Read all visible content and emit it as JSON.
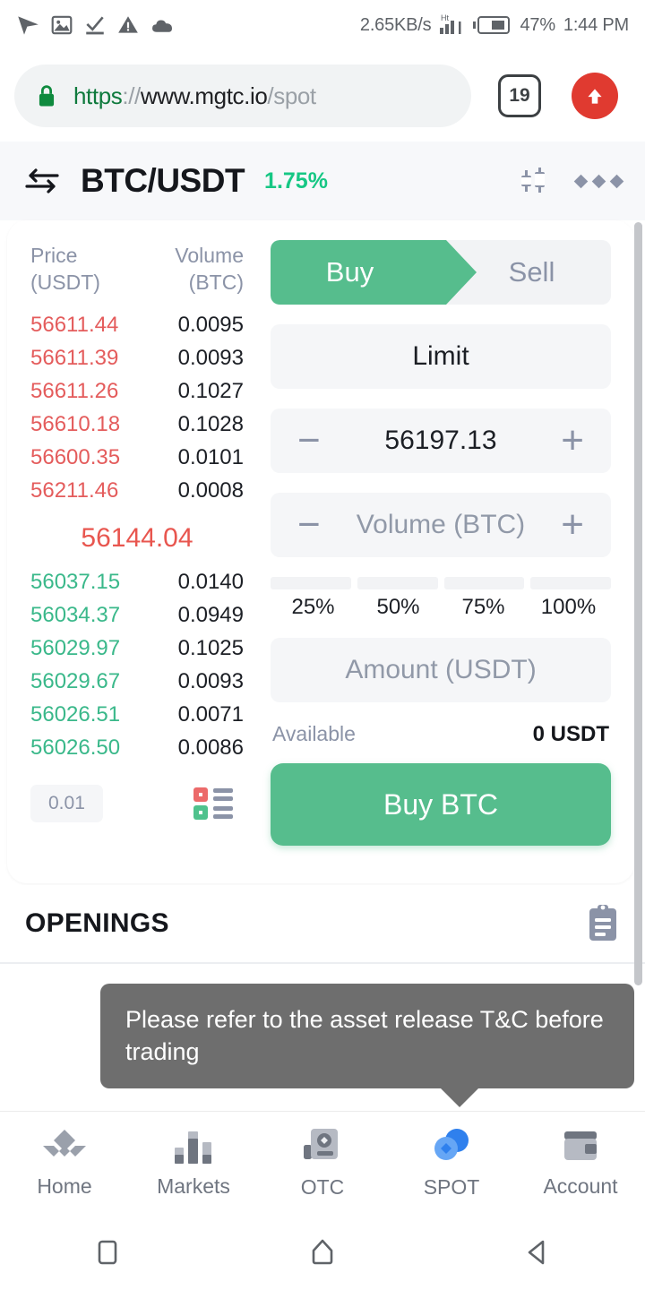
{
  "statusbar": {
    "icons": [
      "send-icon",
      "image-icon",
      "check-download-icon",
      "warning-icon",
      "cloud-icon"
    ],
    "network_speed": "2.65KB/s",
    "battery_percent": "47%",
    "time": "1:44 PM"
  },
  "browser": {
    "url_scheme": "https",
    "url_sep": "://",
    "url_host": "www.mgtc.io",
    "url_path": "/spot",
    "tab_count": "19",
    "lock_icon": "lock-icon",
    "upload_icon": "upload-arrow-icon"
  },
  "app_header": {
    "swap_icon": "swap-arrows-icon",
    "pair": "BTC/USDT",
    "change_percent": "1.75%",
    "change_color": "#16c784",
    "chart_icon": "candlestick-icon",
    "menu_icon": "more-options-icon"
  },
  "orderbook": {
    "header_price_line1": "Price",
    "header_price_line2": "(USDT)",
    "header_volume_line1": "Volume",
    "header_volume_line2": "(BTC)",
    "ask_color": "#e45c5c",
    "bid_color": "#3ab88a",
    "asks": [
      {
        "price": "56611.44",
        "volume": "0.0095"
      },
      {
        "price": "56611.39",
        "volume": "0.0093"
      },
      {
        "price": "56611.26",
        "volume": "0.1027"
      },
      {
        "price": "56610.18",
        "volume": "0.1028"
      },
      {
        "price": "56600.35",
        "volume": "0.0101"
      },
      {
        "price": "56211.46",
        "volume": "0.0008"
      }
    ],
    "last_price": "56144.04",
    "bids": [
      {
        "price": "56037.15",
        "volume": "0.0140"
      },
      {
        "price": "56034.37",
        "volume": "0.0949"
      },
      {
        "price": "56029.97",
        "volume": "0.1025"
      },
      {
        "price": "56029.67",
        "volume": "0.0093"
      },
      {
        "price": "56026.51",
        "volume": "0.0071"
      },
      {
        "price": "56026.50",
        "volume": "0.0086"
      }
    ],
    "tick_size": "0.01",
    "depth_toggle_icon": "orderbook-display-icon"
  },
  "order_form": {
    "buy_label": "Buy",
    "sell_label": "Sell",
    "active_side": "Buy",
    "buy_color": "#56bd8d",
    "order_type": "Limit",
    "price_value": "56197.13",
    "volume_placeholder": "Volume (BTC)",
    "minus_icon": "minus-icon",
    "plus_icon": "plus-icon",
    "percentages": [
      "25%",
      "50%",
      "75%",
      "100%"
    ],
    "amount_placeholder": "Amount (USDT)",
    "available_label": "Available",
    "available_value": "0 USDT",
    "submit_label": "Buy BTC"
  },
  "openings": {
    "title": "OPENINGS",
    "icon": "clipboard-orders-icon"
  },
  "toast": {
    "message": "Please refer to the asset release T&C before trading",
    "background": "#6e6e6e"
  },
  "bottom_nav": {
    "items": [
      {
        "label": "Home",
        "icon": "home-diamond-icon",
        "active": false
      },
      {
        "label": "Markets",
        "icon": "bar-chart-icon",
        "active": false
      },
      {
        "label": "OTC",
        "icon": "otc-document-icon",
        "active": false
      },
      {
        "label": "SPOT",
        "icon": "spot-circles-icon",
        "active": true
      },
      {
        "label": "Account",
        "icon": "wallet-icon",
        "active": false
      }
    ],
    "active_color": "#2f80ed"
  },
  "android_nav": {
    "recents_icon": "recents-square-icon",
    "home_icon": "home-pentagon-icon",
    "back_icon": "back-triangle-icon"
  }
}
